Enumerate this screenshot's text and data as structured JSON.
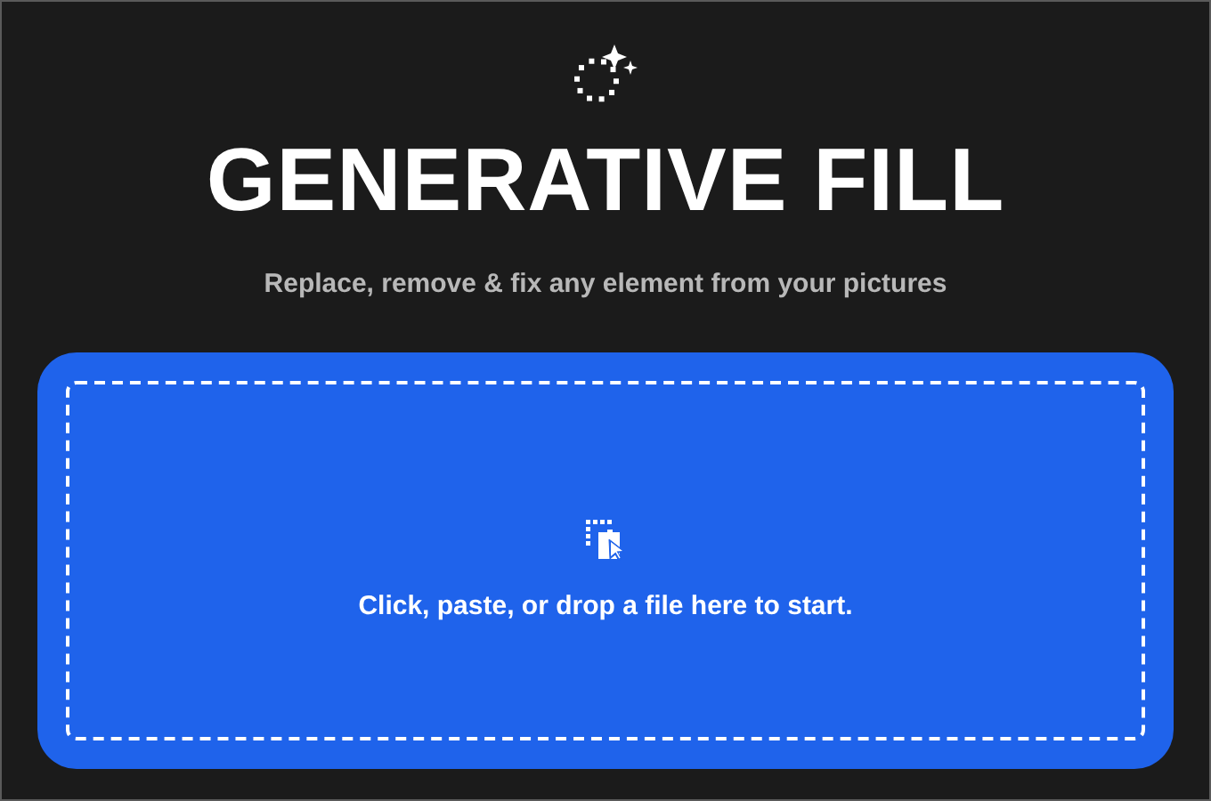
{
  "header": {
    "title": "GENERATIVE FILL",
    "subtitle": "Replace, remove & fix any element from your pictures"
  },
  "dropzone": {
    "label": "Click, paste, or drop a file here to start."
  }
}
